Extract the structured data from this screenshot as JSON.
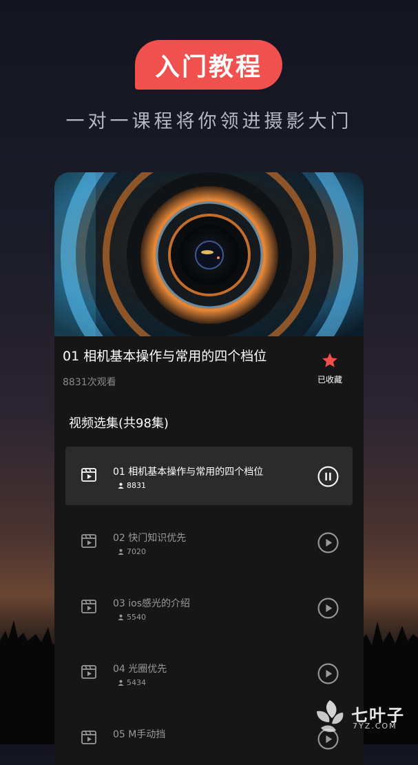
{
  "header": {
    "badge": "入门教程",
    "subtitle": "一对一课程将你领进摄影大门"
  },
  "course": {
    "title": "01 相机基本操作与常用的四个档位",
    "views": "8831次观看",
    "favorite_label": "已收藏",
    "favorite_icon": "star-icon",
    "accent": "#f0504e"
  },
  "episodes_section": {
    "title": "视频选集(共98集)",
    "items": [
      {
        "title": "01 相机基本操作与常用的四个档位",
        "views": "8831",
        "state": "pause",
        "active": true
      },
      {
        "title": "02 快门知识优先",
        "views": "7020",
        "state": "play",
        "active": false
      },
      {
        "title": "03 ios感光的介绍",
        "views": "5540",
        "state": "play",
        "active": false
      },
      {
        "title": "04 光圈优先",
        "views": "5434",
        "state": "play",
        "active": false
      },
      {
        "title": "05 M手动挡",
        "views": "",
        "state": "play",
        "active": false
      }
    ]
  },
  "watermark": {
    "name": "七叶子",
    "domain": "7YZ.COM"
  }
}
